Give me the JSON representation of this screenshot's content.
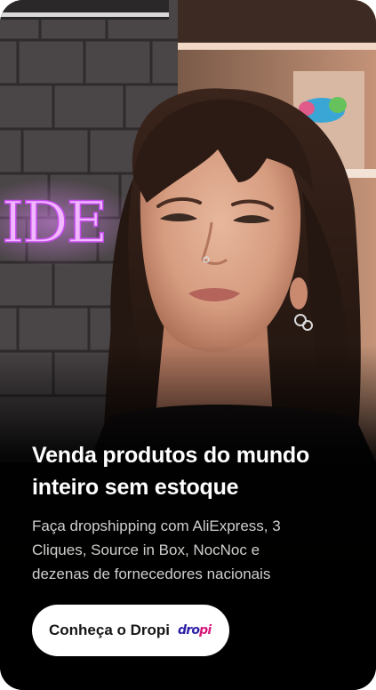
{
  "promo": {
    "headline_line1": "Venda produtos do mundo",
    "headline_line2": "inteiro sem estoque",
    "description_line1": "Faça dropshipping com AliExpress, 3",
    "description_line2": "Cliques, Source in Box, NocNoc e",
    "description_line3": "dezenas de fornecedores nacionais",
    "cta_label": "Conheça o Dropi",
    "logo_text_part1": "dro",
    "logo_text_part2": "pi",
    "neon_sign_text": "IDE"
  },
  "colors": {
    "card_background": "#0b0908",
    "headline": "#ffffff",
    "description": "#cfcfcf",
    "button_background": "#ffffff",
    "button_text": "#161616",
    "logo_primary": "#2a1ea6",
    "logo_accent": "#d8187a",
    "neon_sign": "#e58cff"
  },
  "icons": {
    "brand_logo": "dropi-logo"
  }
}
